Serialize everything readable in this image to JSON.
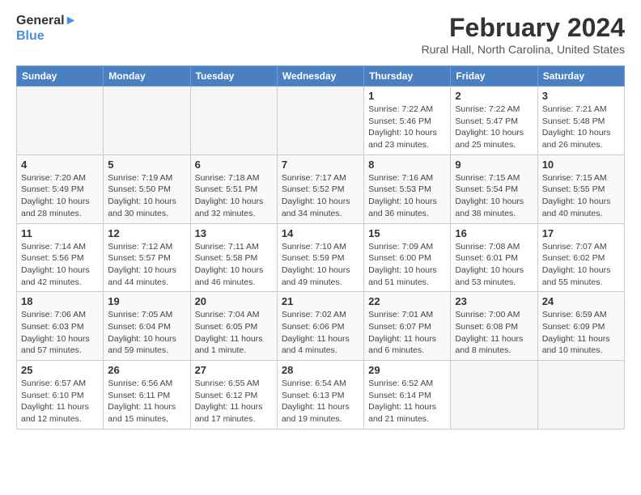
{
  "header": {
    "logo_line1": "General",
    "logo_line2": "Blue",
    "month_year": "February 2024",
    "location": "Rural Hall, North Carolina, United States"
  },
  "weekdays": [
    "Sunday",
    "Monday",
    "Tuesday",
    "Wednesday",
    "Thursday",
    "Friday",
    "Saturday"
  ],
  "weeks": [
    [
      {
        "day": "",
        "info": ""
      },
      {
        "day": "",
        "info": ""
      },
      {
        "day": "",
        "info": ""
      },
      {
        "day": "",
        "info": ""
      },
      {
        "day": "1",
        "info": "Sunrise: 7:22 AM\nSunset: 5:46 PM\nDaylight: 10 hours\nand 23 minutes."
      },
      {
        "day": "2",
        "info": "Sunrise: 7:22 AM\nSunset: 5:47 PM\nDaylight: 10 hours\nand 25 minutes."
      },
      {
        "day": "3",
        "info": "Sunrise: 7:21 AM\nSunset: 5:48 PM\nDaylight: 10 hours\nand 26 minutes."
      }
    ],
    [
      {
        "day": "4",
        "info": "Sunrise: 7:20 AM\nSunset: 5:49 PM\nDaylight: 10 hours\nand 28 minutes."
      },
      {
        "day": "5",
        "info": "Sunrise: 7:19 AM\nSunset: 5:50 PM\nDaylight: 10 hours\nand 30 minutes."
      },
      {
        "day": "6",
        "info": "Sunrise: 7:18 AM\nSunset: 5:51 PM\nDaylight: 10 hours\nand 32 minutes."
      },
      {
        "day": "7",
        "info": "Sunrise: 7:17 AM\nSunset: 5:52 PM\nDaylight: 10 hours\nand 34 minutes."
      },
      {
        "day": "8",
        "info": "Sunrise: 7:16 AM\nSunset: 5:53 PM\nDaylight: 10 hours\nand 36 minutes."
      },
      {
        "day": "9",
        "info": "Sunrise: 7:15 AM\nSunset: 5:54 PM\nDaylight: 10 hours\nand 38 minutes."
      },
      {
        "day": "10",
        "info": "Sunrise: 7:15 AM\nSunset: 5:55 PM\nDaylight: 10 hours\nand 40 minutes."
      }
    ],
    [
      {
        "day": "11",
        "info": "Sunrise: 7:14 AM\nSunset: 5:56 PM\nDaylight: 10 hours\nand 42 minutes."
      },
      {
        "day": "12",
        "info": "Sunrise: 7:12 AM\nSunset: 5:57 PM\nDaylight: 10 hours\nand 44 minutes."
      },
      {
        "day": "13",
        "info": "Sunrise: 7:11 AM\nSunset: 5:58 PM\nDaylight: 10 hours\nand 46 minutes."
      },
      {
        "day": "14",
        "info": "Sunrise: 7:10 AM\nSunset: 5:59 PM\nDaylight: 10 hours\nand 49 minutes."
      },
      {
        "day": "15",
        "info": "Sunrise: 7:09 AM\nSunset: 6:00 PM\nDaylight: 10 hours\nand 51 minutes."
      },
      {
        "day": "16",
        "info": "Sunrise: 7:08 AM\nSunset: 6:01 PM\nDaylight: 10 hours\nand 53 minutes."
      },
      {
        "day": "17",
        "info": "Sunrise: 7:07 AM\nSunset: 6:02 PM\nDaylight: 10 hours\nand 55 minutes."
      }
    ],
    [
      {
        "day": "18",
        "info": "Sunrise: 7:06 AM\nSunset: 6:03 PM\nDaylight: 10 hours\nand 57 minutes."
      },
      {
        "day": "19",
        "info": "Sunrise: 7:05 AM\nSunset: 6:04 PM\nDaylight: 10 hours\nand 59 minutes."
      },
      {
        "day": "20",
        "info": "Sunrise: 7:04 AM\nSunset: 6:05 PM\nDaylight: 11 hours\nand 1 minute."
      },
      {
        "day": "21",
        "info": "Sunrise: 7:02 AM\nSunset: 6:06 PM\nDaylight: 11 hours\nand 4 minutes."
      },
      {
        "day": "22",
        "info": "Sunrise: 7:01 AM\nSunset: 6:07 PM\nDaylight: 11 hours\nand 6 minutes."
      },
      {
        "day": "23",
        "info": "Sunrise: 7:00 AM\nSunset: 6:08 PM\nDaylight: 11 hours\nand 8 minutes."
      },
      {
        "day": "24",
        "info": "Sunrise: 6:59 AM\nSunset: 6:09 PM\nDaylight: 11 hours\nand 10 minutes."
      }
    ],
    [
      {
        "day": "25",
        "info": "Sunrise: 6:57 AM\nSunset: 6:10 PM\nDaylight: 11 hours\nand 12 minutes."
      },
      {
        "day": "26",
        "info": "Sunrise: 6:56 AM\nSunset: 6:11 PM\nDaylight: 11 hours\nand 15 minutes."
      },
      {
        "day": "27",
        "info": "Sunrise: 6:55 AM\nSunset: 6:12 PM\nDaylight: 11 hours\nand 17 minutes."
      },
      {
        "day": "28",
        "info": "Sunrise: 6:54 AM\nSunset: 6:13 PM\nDaylight: 11 hours\nand 19 minutes."
      },
      {
        "day": "29",
        "info": "Sunrise: 6:52 AM\nSunset: 6:14 PM\nDaylight: 11 hours\nand 21 minutes."
      },
      {
        "day": "",
        "info": ""
      },
      {
        "day": "",
        "info": ""
      }
    ]
  ]
}
